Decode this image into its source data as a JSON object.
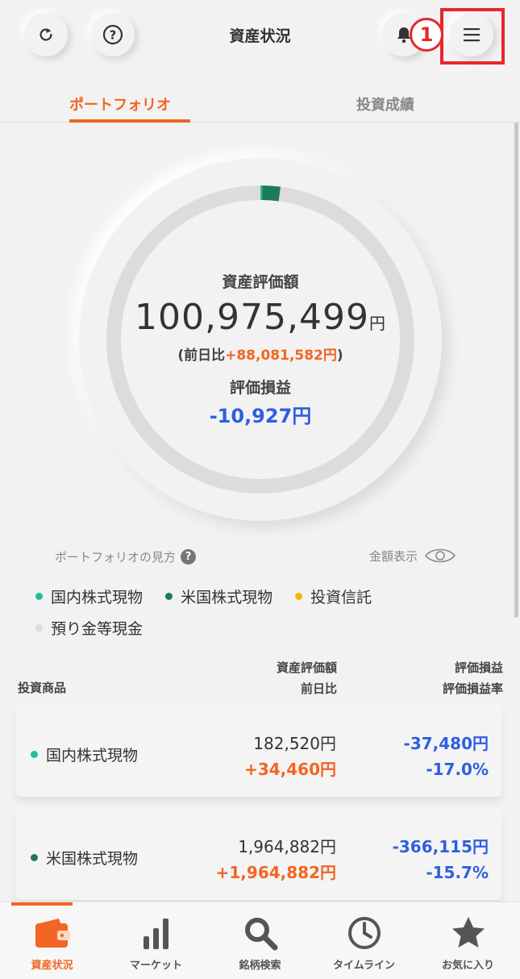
{
  "header": {
    "title": "資産状況",
    "annotation_number": "1"
  },
  "tabs": [
    {
      "label": "ポートフォリオ",
      "active": true
    },
    {
      "label": "投資成績",
      "active": false
    }
  ],
  "summary": {
    "asset_label": "資産評価額",
    "asset_value": "100,975,499",
    "asset_unit": "円",
    "prev_prefix": "(前日比",
    "prev_value": "+88,081,582円",
    "prev_suffix": ")",
    "pl_label": "評価損益",
    "pl_value": "-10,927円"
  },
  "chart_data": {
    "type": "pie",
    "categories": [
      "国内株式現物",
      "米国株式現物",
      "投資信託",
      "預り金等現金"
    ],
    "values": [
      0.2,
      1.9,
      0,
      97.9
    ],
    "colors": [
      "#1fbf9c",
      "#1d7a5a",
      "#f5b800",
      "#dcdcdc"
    ]
  },
  "help": {
    "howto_label": "ポートフォリオの見方",
    "amount_toggle_label": "金額表示"
  },
  "legend": [
    {
      "label": "国内株式現物",
      "color": "#1fbf9c"
    },
    {
      "label": "米国株式現物",
      "color": "#1d7a5a"
    },
    {
      "label": "投資信託",
      "color": "#f5b800"
    },
    {
      "label": "預り金等現金",
      "color": "#dcdcdc"
    }
  ],
  "table": {
    "col_name": "投資商品",
    "col_value_1": "資産評価額",
    "col_value_2": "前日比",
    "col_pl_1": "評価損益",
    "col_pl_2": "評価損益率",
    "rows": [
      {
        "name": "国内株式現物",
        "color": "#1fbf9c",
        "value": "182,520円",
        "change": "+34,460円",
        "pl": "-37,480円",
        "pl_rate": "-17.0%"
      },
      {
        "name": "米国株式現物",
        "color": "#1d7a5a",
        "value": "1,964,882円",
        "change": "+1,964,882円",
        "pl": "-366,115円",
        "pl_rate": "-15.7%"
      }
    ]
  },
  "bottom_nav": [
    {
      "label": "資産状況",
      "icon": "wallet-icon",
      "active": true
    },
    {
      "label": "マーケット",
      "icon": "bar-chart-icon",
      "active": false
    },
    {
      "label": "銘柄検索",
      "icon": "search-icon",
      "active": false
    },
    {
      "label": "タイムライン",
      "icon": "clock-icon",
      "active": false
    },
    {
      "label": "お気に入り",
      "icon": "star-icon",
      "active": false
    }
  ]
}
